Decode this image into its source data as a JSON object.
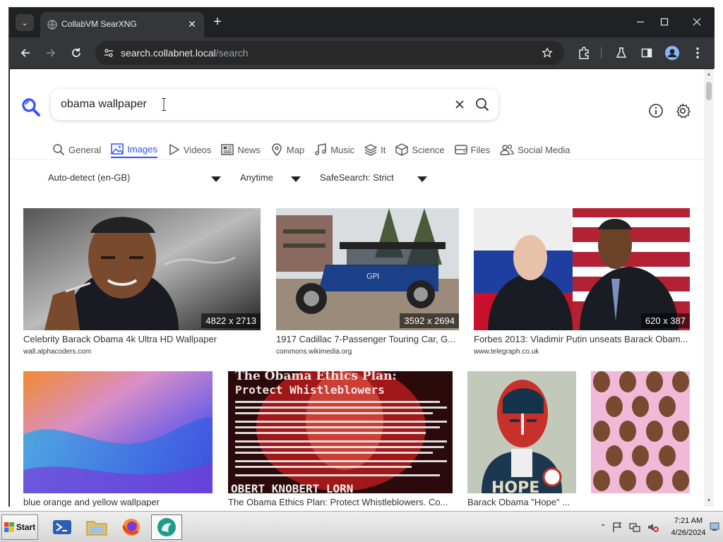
{
  "browser": {
    "tab_title": "CollabVM SearXNG",
    "url_host": "search.collabnet.local",
    "url_path": "/search"
  },
  "search": {
    "query": "obama wallpaper"
  },
  "categories": [
    {
      "label": "General",
      "icon": "search-icon"
    },
    {
      "label": "Images",
      "icon": "image-icon",
      "active": true
    },
    {
      "label": "Videos",
      "icon": "play-icon"
    },
    {
      "label": "News",
      "icon": "newspaper-icon"
    },
    {
      "label": "Map",
      "icon": "map-pin-icon"
    },
    {
      "label": "Music",
      "icon": "music-note-icon"
    },
    {
      "label": "It",
      "icon": "layers-icon"
    },
    {
      "label": "Science",
      "icon": "cube-icon"
    },
    {
      "label": "Files",
      "icon": "drive-icon"
    },
    {
      "label": "Social Media",
      "icon": "people-icon"
    }
  ],
  "filters": {
    "language": "Auto-detect (en-GB)",
    "time": "Anytime",
    "safesearch": "SafeSearch: Strict"
  },
  "results": [
    {
      "title": "Celebrity Barack Obama 4k Ultra HD Wallpaper",
      "url": "wall.alphacoders.com",
      "size": "4822 x 2713"
    },
    {
      "title": "1917 Cadillac 7-Passenger Touring Car, G...",
      "url": "commons.wikimedia.org",
      "size": "3592 x 2694"
    },
    {
      "title": "Forbes 2013: Vladimir Putin unseats Barack Obam...",
      "url": "www.telegraph.co.uk",
      "size": "620 x 387"
    },
    {
      "title": "blue orange and yellow wallpaper",
      "url": "",
      "size": ""
    },
    {
      "title": "The Obama Ethics Plan: Protect Whistleblowers. Co...",
      "url": "",
      "size": ""
    },
    {
      "title": "Barack Obama \"Hope\" ...",
      "url": "",
      "size": ""
    },
    {
      "title": "",
      "url": "",
      "size": ""
    }
  ],
  "poster": {
    "heading_1": "The Obama Ethics Plan:",
    "heading_2": "Protect Whistleblowers",
    "footer": "OBERT KNOBERT LORN"
  },
  "hope_poster": {
    "word": "HOPE"
  },
  "taskbar": {
    "start_label": "Start",
    "time": "7:21 AM",
    "date": "4/26/2024"
  },
  "colors": {
    "accent": "#3050ff",
    "chrome_dark": "#202124",
    "chrome_toolbar": "#35363a"
  }
}
